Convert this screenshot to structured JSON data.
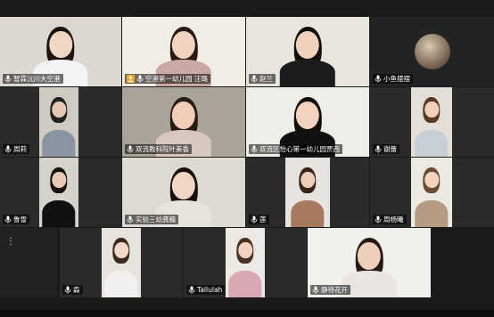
{
  "tiles": [
    {
      "id": "t1",
      "name": "智霖沅川大空港",
      "video": true,
      "bg": "#dcd8d0",
      "hair": "#1b1410",
      "skin": "#f1d6c4",
      "cloth": "#f3f3f3"
    },
    {
      "id": "t2",
      "name": "空港第一幼儿园  汪璐",
      "video": true,
      "bg": "#f0ece6",
      "hair": "#2a1a12",
      "skin": "#f2d3c0",
      "cloth": "#c9a9a2",
      "badge": true
    },
    {
      "id": "t3",
      "name": "赵兰",
      "video": true,
      "bg": "#e8e4de",
      "hair": "#120c09",
      "skin": "#efd0bd",
      "cloth": "#1c1c1c"
    },
    {
      "id": "t4",
      "name": "小鱼摆摆",
      "video": false,
      "avatar": true
    },
    {
      "id": "t5",
      "name": "周莉",
      "video": true,
      "bg": "#cfcac2",
      "hair": "#222",
      "skin": "#e6c7b3",
      "cloth": "#8a94a3"
    },
    {
      "id": "t6",
      "name": "双流教科院叶美香",
      "video": true,
      "bg": "#a9a39a",
      "hair": "#2a1a14",
      "skin": "#efcdb8",
      "cloth": "#d8c7c0"
    },
    {
      "id": "t7",
      "name": "双流区怡心第一幼儿园贾西",
      "video": true,
      "bg": "#efede8",
      "hair": "#130d0a",
      "skin": "#f0d2be",
      "cloth": "#111"
    },
    {
      "id": "t8",
      "name": "谢蕾",
      "video": true,
      "bg": "#e3dfd8",
      "hair": "#5a3a24",
      "skin": "#f0d0bc",
      "cloth": "#c8ced6"
    },
    {
      "id": "t9",
      "name": "鲁雪",
      "video": true,
      "bg": "#d5d1cb",
      "hair": "#1a120e",
      "skin": "#e9c8b4",
      "cloth": "#111"
    },
    {
      "id": "t10",
      "name": "实验三幼龚巍",
      "video": true,
      "bg": "#ddd9d3",
      "hair": "#18100c",
      "skin": "#f2d6c5",
      "cloth": "#e7e2dc"
    },
    {
      "id": "t11",
      "name": "莲",
      "video": true,
      "bg": "#e7e4df",
      "hair": "#3a2418",
      "skin": "#eccdb9",
      "cloth": "#a7795f"
    },
    {
      "id": "t12",
      "name": "周杨曦",
      "video": true,
      "bg": "#ece9e3",
      "hair": "#6a4a32",
      "skin": "#f1d3c0",
      "cloth": "#b59a84"
    },
    {
      "id": "t13",
      "name": "",
      "video": false
    },
    {
      "id": "t14",
      "name": "森",
      "video": true,
      "bg": "#e6e2dc",
      "hair": "#3a2a20",
      "skin": "#f3d7c7",
      "cloth": "#f2f0ee"
    },
    {
      "id": "t15",
      "name": "Tallulah",
      "video": true,
      "bg": "#ece8e3",
      "hair": "#4a3224",
      "skin": "#f1d2c0",
      "cloth": "#d9a8b4"
    },
    {
      "id": "t16",
      "name": "静待花开",
      "video": true,
      "bg": "#f2f0ed",
      "hair": "#261a14",
      "skin": "#efcfbb",
      "cloth": "#e9e5e0"
    }
  ],
  "more_icon": "more-vertical-icon",
  "mic_icon": "microphone-icon"
}
